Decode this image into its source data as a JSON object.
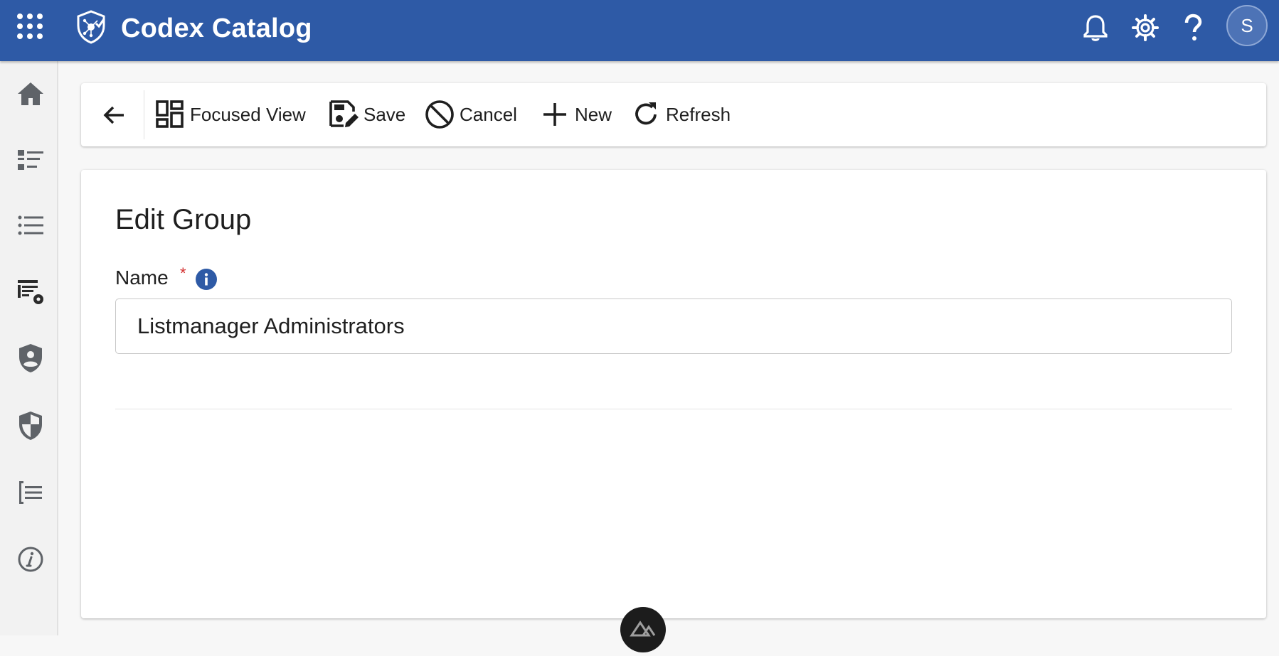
{
  "app": {
    "title": "Codex Catalog",
    "user_initial": "S"
  },
  "toolbar": {
    "focused_view_label": "Focused View",
    "save_label": "Save",
    "cancel_label": "Cancel",
    "new_label": "New",
    "refresh_label": "Refresh"
  },
  "form": {
    "heading": "Edit Group",
    "name_label": "Name",
    "required_marker": "*",
    "name_value": "Listmanager Administrators"
  },
  "icons": {
    "apps": "apps-grid-icon",
    "logo": "shield-network-logo",
    "notifications": "bell-icon",
    "settings": "gear-icon",
    "help": "question-icon",
    "back": "arrow-left-icon",
    "focused_view": "dashboard-icon",
    "save": "save-edit-icon",
    "cancel": "block-icon",
    "new": "plus-icon",
    "refresh": "refresh-icon",
    "info": "info-icon",
    "sidebar": [
      "home-icon",
      "list-detail-icon",
      "bulleted-list-icon",
      "list-settings-icon",
      "person-shield-icon",
      "shield-icon",
      "list-bracket-icon",
      "info-outline-icon"
    ]
  },
  "colors": {
    "header_bg": "#2e5aa6",
    "accent": "#2e5aa6",
    "required": "#d32f2f"
  }
}
